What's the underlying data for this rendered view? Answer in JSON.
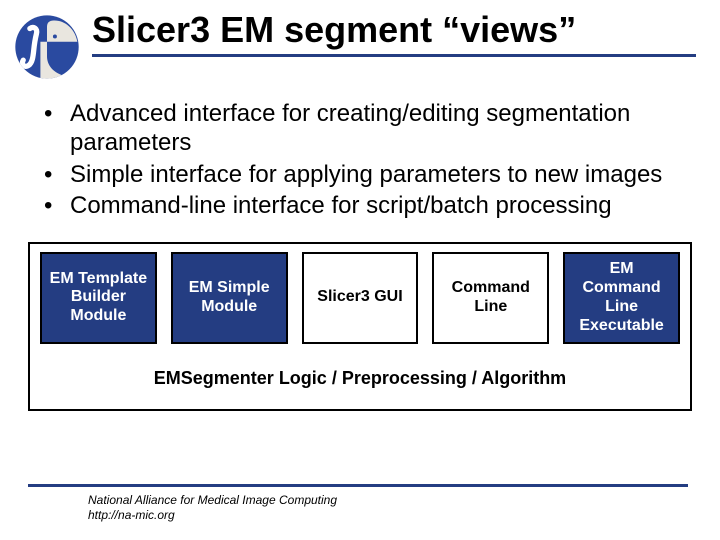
{
  "title": "Slicer3 EM segment “views”",
  "bullets": [
    "Advanced interface for creating/editing segmentation parameters",
    "Simple interface for applying parameters to new images",
    "Command-line interface for script/batch processing"
  ],
  "diagram": {
    "row1": [
      {
        "label": "EM Template\nBuilder\nModule",
        "style": "dark"
      },
      {
        "label": "EM Simple\nModule",
        "style": "dark"
      },
      {
        "label": "Slicer3 GUI",
        "style": "light"
      },
      {
        "label": "Command\nLine",
        "style": "light"
      },
      {
        "label": "EM Command\nLine\nExecutable",
        "style": "dark"
      }
    ],
    "logic": "EMSegmenter Logic / Preprocessing / Algorithm"
  },
  "footer": {
    "line1": "National Alliance for Medical Image Computing",
    "line2": "http://na-mic.org"
  },
  "icon_name": "integral-head-icon"
}
